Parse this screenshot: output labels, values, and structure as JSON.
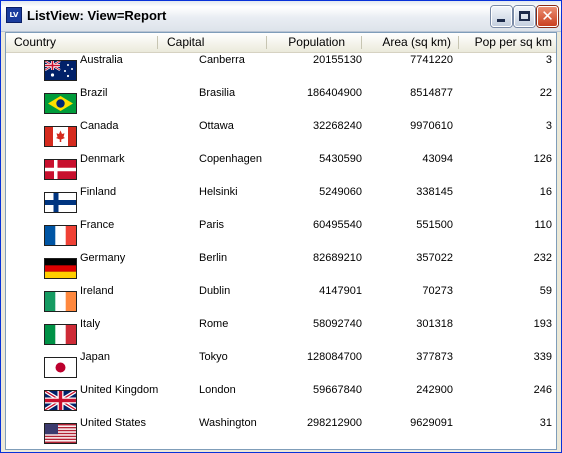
{
  "window": {
    "title": "ListView: View=Report",
    "app_icon": "list-view-app-icon",
    "controls": {
      "minimize": "minimize-icon",
      "maximize": "maximize-icon",
      "close": "close-icon",
      "close_glyph": "✕"
    }
  },
  "columns": [
    "Country",
    "Capital",
    "Population",
    "Area (sq km)",
    "Pop per sq km"
  ],
  "rows": [
    {
      "country": "Australia",
      "capital": "Canberra",
      "population": "20155130",
      "area": "7741220",
      "density": "3",
      "flag": "australia"
    },
    {
      "country": "Brazil",
      "capital": "Brasilia",
      "population": "186404900",
      "area": "8514877",
      "density": "22",
      "flag": "brazil"
    },
    {
      "country": "Canada",
      "capital": "Ottawa",
      "population": "32268240",
      "area": "9970610",
      "density": "3",
      "flag": "canada"
    },
    {
      "country": "Denmark",
      "capital": "Copenhagen",
      "population": "5430590",
      "area": "43094",
      "density": "126",
      "flag": "denmark"
    },
    {
      "country": "Finland",
      "capital": "Helsinki",
      "population": "5249060",
      "area": "338145",
      "density": "16",
      "flag": "finland"
    },
    {
      "country": "France",
      "capital": "Paris",
      "population": "60495540",
      "area": "551500",
      "density": "110",
      "flag": "france"
    },
    {
      "country": "Germany",
      "capital": "Berlin",
      "population": "82689210",
      "area": "357022",
      "density": "232",
      "flag": "germany"
    },
    {
      "country": "Ireland",
      "capital": "Dublin",
      "population": "4147901",
      "area": "70273",
      "density": "59",
      "flag": "ireland"
    },
    {
      "country": "Italy",
      "capital": "Rome",
      "population": "58092740",
      "area": "301318",
      "density": "193",
      "flag": "italy"
    },
    {
      "country": "Japan",
      "capital": "Tokyo",
      "population": "128084700",
      "area": "377873",
      "density": "339",
      "flag": "japan"
    },
    {
      "country": "United Kingdom",
      "capital": "London",
      "population": "59667840",
      "area": "242900",
      "density": "246",
      "flag": "united-kingdom"
    },
    {
      "country": "United States",
      "capital": "Washington",
      "population": "298212900",
      "area": "9629091",
      "density": "31",
      "flag": "united-states"
    }
  ]
}
